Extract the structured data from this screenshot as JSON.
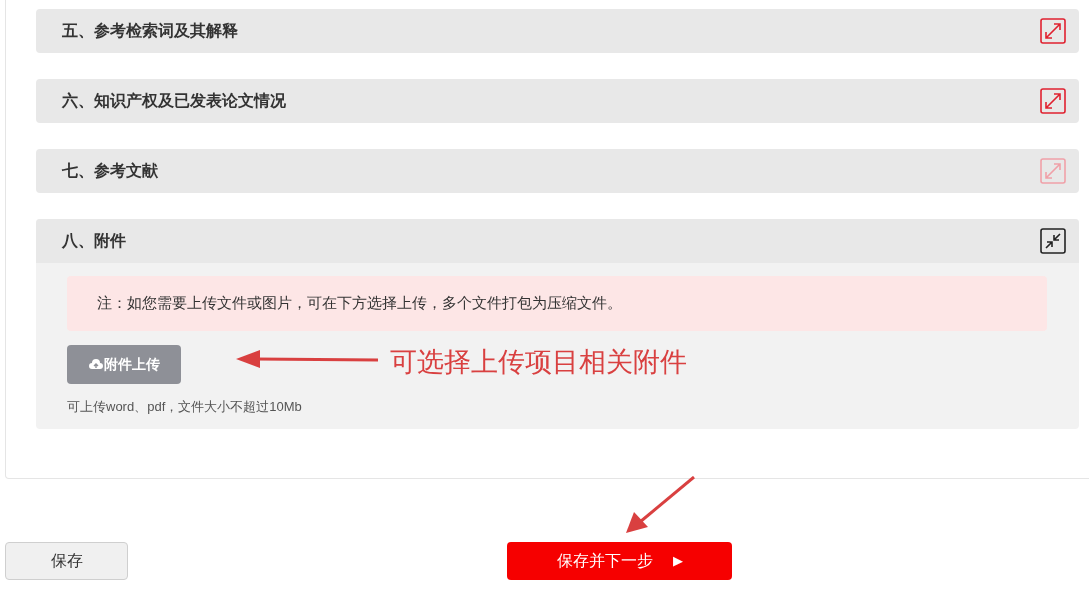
{
  "sections": [
    {
      "title": "五、参考检索词及其解释",
      "expanded": false,
      "disabled": false
    },
    {
      "title": "六、知识产权及已发表论文情况",
      "expanded": false,
      "disabled": false
    },
    {
      "title": "七、参考文献",
      "expanded": false,
      "disabled": true
    },
    {
      "title": "八、附件",
      "expanded": true,
      "disabled": false,
      "note": "注：如您需要上传文件或图片，可在下方选择上传，多个文件打包为压缩文件。",
      "upload_button": "附件上传",
      "hint": "可上传word、pdf，文件大小不超过10Mb"
    }
  ],
  "annotation": {
    "text": "可选择上传项目相关附件"
  },
  "buttons": {
    "save": "保存",
    "next": "保存并下一步",
    "next_icon": "▶"
  }
}
